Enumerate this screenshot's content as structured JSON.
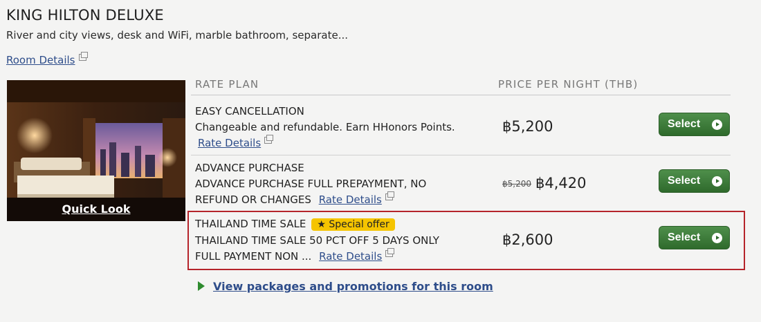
{
  "room": {
    "title": "KING HILTON DELUXE",
    "description": "River and city views, desk and WiFi, marble bathroom, separate...",
    "details_link": "Room Details",
    "quick_look": "Quick Look"
  },
  "table": {
    "rate_plan_header": "RATE PLAN",
    "price_header": "PRICE PER NIGHT (THB)"
  },
  "rates": [
    {
      "name": "EASY CANCELLATION",
      "desc_line1": "Changeable and refundable. Earn HHonors Points.",
      "details_link": "Rate Details",
      "price": "฿5,200",
      "select_label": "Select"
    },
    {
      "name": "ADVANCE PURCHASE",
      "desc_line1": "ADVANCE PURCHASE FULL PREPAYMENT, NO",
      "desc_line2": "REFUND OR CHANGES",
      "details_link": "Rate Details",
      "old_price": "฿5,200",
      "price": "฿4,420",
      "select_label": "Select"
    },
    {
      "name": "THAILAND TIME SALE",
      "badge": "★ Special offer",
      "desc_line1": "THAILAND TIME SALE 50 PCT OFF 5 DAYS ONLY",
      "desc_line2": "FULL PAYMENT NON ...",
      "details_link": "Rate Details",
      "price": "฿2,600",
      "select_label": "Select"
    }
  ],
  "packages_link": "View packages and promotions for this room",
  "colors": {
    "link": "#2e4d8a",
    "select_button": "#3a7a36",
    "badge": "#f5c400",
    "highlight_border": "#b5242a"
  }
}
